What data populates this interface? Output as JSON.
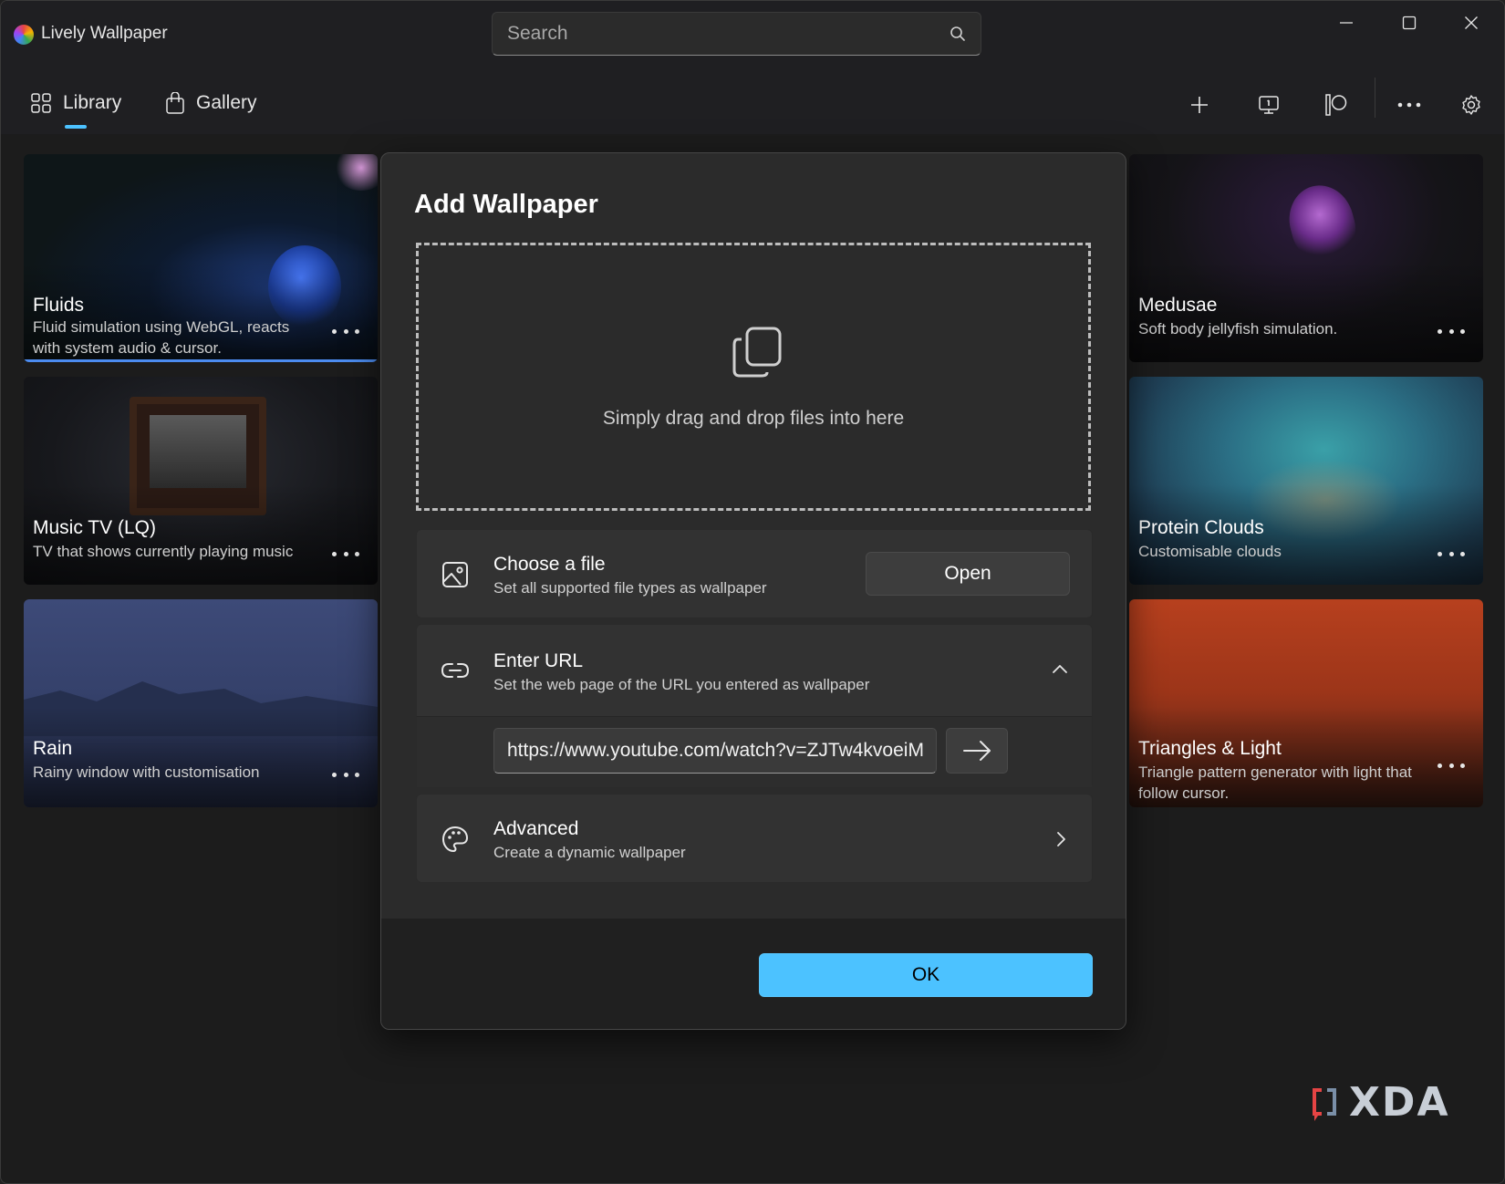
{
  "app": {
    "title": "Lively Wallpaper"
  },
  "search": {
    "placeholder": "Search"
  },
  "nav": {
    "tabs": [
      {
        "label": "Library",
        "icon": "grid-icon",
        "active": true
      },
      {
        "label": "Gallery",
        "icon": "shopping-bag-icon",
        "active": false
      }
    ],
    "tools": [
      "add-icon",
      "screen-icon",
      "patreon-icon",
      "more-icon",
      "gear-icon"
    ]
  },
  "wallpapers": [
    {
      "title": "Fluids",
      "description": "Fluid simulation using WebGL, reacts with system audio & cursor.",
      "selected": true
    },
    {
      "title": "Music TV (LQ)",
      "description": "TV that shows currently playing music",
      "selected": false
    },
    {
      "title": "Rain",
      "description": "Rainy window with customisation",
      "selected": false
    },
    {
      "title": "Medusae",
      "description": "Soft body jellyfish simulation.",
      "selected": false
    },
    {
      "title": "Protein Clouds",
      "description": "Customisable clouds",
      "selected": false
    },
    {
      "title": "Triangles & Light",
      "description": "Triangle pattern generator with light that follow cursor.",
      "selected": false
    }
  ],
  "dialog": {
    "title": "Add Wallpaper",
    "drop_text": "Simply drag and drop files into here",
    "choose_file": {
      "title": "Choose a file",
      "subtitle": "Set all supported file types as wallpaper",
      "button": "Open"
    },
    "enter_url": {
      "title": "Enter URL",
      "subtitle": "Set the web page of the URL you entered as wallpaper",
      "value": "https://www.youtube.com/watch?v=ZJTw4kvoeiM",
      "expanded": true
    },
    "advanced": {
      "title": "Advanced",
      "subtitle": "Create a dynamic wallpaper"
    },
    "ok": "OK"
  },
  "watermark": {
    "text": "XDA"
  },
  "colors": {
    "accent": "#4cc2ff",
    "background": "#1c1c1c",
    "dialog": "#2b2b2b",
    "selection": "#4c8cf0"
  }
}
